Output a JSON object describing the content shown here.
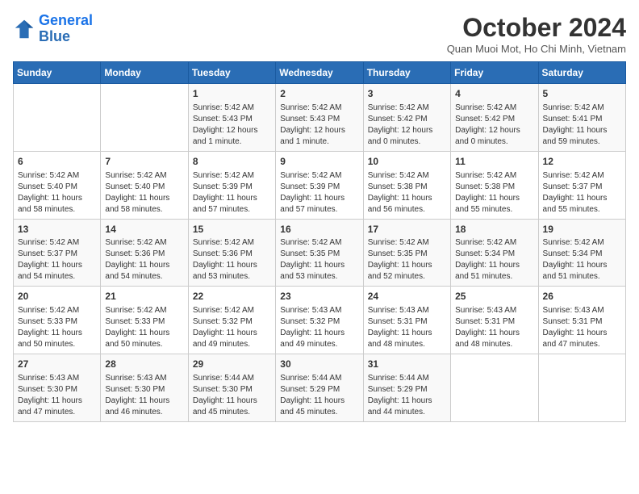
{
  "header": {
    "logo_line1": "General",
    "logo_line2": "Blue",
    "month_year": "October 2024",
    "location": "Quan Muoi Mot, Ho Chi Minh, Vietnam"
  },
  "days_of_week": [
    "Sunday",
    "Monday",
    "Tuesday",
    "Wednesday",
    "Thursday",
    "Friday",
    "Saturday"
  ],
  "weeks": [
    [
      {
        "day": "",
        "content": ""
      },
      {
        "day": "",
        "content": ""
      },
      {
        "day": "1",
        "content": "Sunrise: 5:42 AM\nSunset: 5:43 PM\nDaylight: 12 hours\nand 1 minute."
      },
      {
        "day": "2",
        "content": "Sunrise: 5:42 AM\nSunset: 5:43 PM\nDaylight: 12 hours\nand 1 minute."
      },
      {
        "day": "3",
        "content": "Sunrise: 5:42 AM\nSunset: 5:42 PM\nDaylight: 12 hours\nand 0 minutes."
      },
      {
        "day": "4",
        "content": "Sunrise: 5:42 AM\nSunset: 5:42 PM\nDaylight: 12 hours\nand 0 minutes."
      },
      {
        "day": "5",
        "content": "Sunrise: 5:42 AM\nSunset: 5:41 PM\nDaylight: 11 hours\nand 59 minutes."
      }
    ],
    [
      {
        "day": "6",
        "content": "Sunrise: 5:42 AM\nSunset: 5:40 PM\nDaylight: 11 hours\nand 58 minutes."
      },
      {
        "day": "7",
        "content": "Sunrise: 5:42 AM\nSunset: 5:40 PM\nDaylight: 11 hours\nand 58 minutes."
      },
      {
        "day": "8",
        "content": "Sunrise: 5:42 AM\nSunset: 5:39 PM\nDaylight: 11 hours\nand 57 minutes."
      },
      {
        "day": "9",
        "content": "Sunrise: 5:42 AM\nSunset: 5:39 PM\nDaylight: 11 hours\nand 57 minutes."
      },
      {
        "day": "10",
        "content": "Sunrise: 5:42 AM\nSunset: 5:38 PM\nDaylight: 11 hours\nand 56 minutes."
      },
      {
        "day": "11",
        "content": "Sunrise: 5:42 AM\nSunset: 5:38 PM\nDaylight: 11 hours\nand 55 minutes."
      },
      {
        "day": "12",
        "content": "Sunrise: 5:42 AM\nSunset: 5:37 PM\nDaylight: 11 hours\nand 55 minutes."
      }
    ],
    [
      {
        "day": "13",
        "content": "Sunrise: 5:42 AM\nSunset: 5:37 PM\nDaylight: 11 hours\nand 54 minutes."
      },
      {
        "day": "14",
        "content": "Sunrise: 5:42 AM\nSunset: 5:36 PM\nDaylight: 11 hours\nand 54 minutes."
      },
      {
        "day": "15",
        "content": "Sunrise: 5:42 AM\nSunset: 5:36 PM\nDaylight: 11 hours\nand 53 minutes."
      },
      {
        "day": "16",
        "content": "Sunrise: 5:42 AM\nSunset: 5:35 PM\nDaylight: 11 hours\nand 53 minutes."
      },
      {
        "day": "17",
        "content": "Sunrise: 5:42 AM\nSunset: 5:35 PM\nDaylight: 11 hours\nand 52 minutes."
      },
      {
        "day": "18",
        "content": "Sunrise: 5:42 AM\nSunset: 5:34 PM\nDaylight: 11 hours\nand 51 minutes."
      },
      {
        "day": "19",
        "content": "Sunrise: 5:42 AM\nSunset: 5:34 PM\nDaylight: 11 hours\nand 51 minutes."
      }
    ],
    [
      {
        "day": "20",
        "content": "Sunrise: 5:42 AM\nSunset: 5:33 PM\nDaylight: 11 hours\nand 50 minutes."
      },
      {
        "day": "21",
        "content": "Sunrise: 5:42 AM\nSunset: 5:33 PM\nDaylight: 11 hours\nand 50 minutes."
      },
      {
        "day": "22",
        "content": "Sunrise: 5:42 AM\nSunset: 5:32 PM\nDaylight: 11 hours\nand 49 minutes."
      },
      {
        "day": "23",
        "content": "Sunrise: 5:43 AM\nSunset: 5:32 PM\nDaylight: 11 hours\nand 49 minutes."
      },
      {
        "day": "24",
        "content": "Sunrise: 5:43 AM\nSunset: 5:31 PM\nDaylight: 11 hours\nand 48 minutes."
      },
      {
        "day": "25",
        "content": "Sunrise: 5:43 AM\nSunset: 5:31 PM\nDaylight: 11 hours\nand 48 minutes."
      },
      {
        "day": "26",
        "content": "Sunrise: 5:43 AM\nSunset: 5:31 PM\nDaylight: 11 hours\nand 47 minutes."
      }
    ],
    [
      {
        "day": "27",
        "content": "Sunrise: 5:43 AM\nSunset: 5:30 PM\nDaylight: 11 hours\nand 47 minutes."
      },
      {
        "day": "28",
        "content": "Sunrise: 5:43 AM\nSunset: 5:30 PM\nDaylight: 11 hours\nand 46 minutes."
      },
      {
        "day": "29",
        "content": "Sunrise: 5:44 AM\nSunset: 5:30 PM\nDaylight: 11 hours\nand 45 minutes."
      },
      {
        "day": "30",
        "content": "Sunrise: 5:44 AM\nSunset: 5:29 PM\nDaylight: 11 hours\nand 45 minutes."
      },
      {
        "day": "31",
        "content": "Sunrise: 5:44 AM\nSunset: 5:29 PM\nDaylight: 11 hours\nand 44 minutes."
      },
      {
        "day": "",
        "content": ""
      },
      {
        "day": "",
        "content": ""
      }
    ]
  ]
}
